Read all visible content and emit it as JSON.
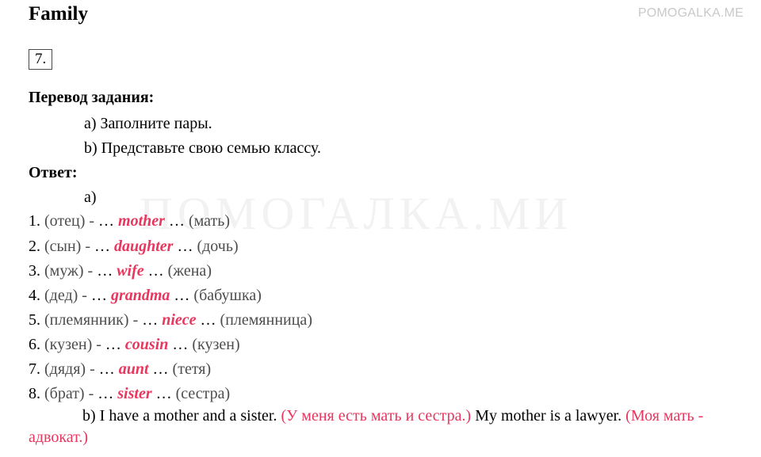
{
  "watermarks": {
    "top_right": "POMOGALKA.ME",
    "center": "ПОМОГАЛКА.МИ"
  },
  "document": {
    "title": "Family",
    "task_number": "7.",
    "translation_heading": "Перевод задания:",
    "translation_lines": [
      "a) Заполните пары.",
      "b) Представьте свою семью классу."
    ],
    "answer_heading": "Ответ:",
    "answer_part_a_label": "a)",
    "pairs": [
      {
        "num": "1.",
        "prompt": "(отец) -",
        "dots_before": "…",
        "answer": "mother",
        "dots_after": "…",
        "translation": "(мать)"
      },
      {
        "num": "2.",
        "prompt": "(сын) -",
        "dots_before": "…",
        "answer": "daughter",
        "dots_after": "…",
        "translation": "(дочь)"
      },
      {
        "num": "3.",
        "prompt": "(муж) -",
        "dots_before": "…",
        "answer": "wife",
        "dots_after": "…",
        "translation": "(жена)"
      },
      {
        "num": "4.",
        "prompt": "(дед) -",
        "dots_before": "…",
        "answer": "grandma",
        "dots_after": "…",
        "translation": "(бабушка)"
      },
      {
        "num": "5.",
        "prompt": "(племянник) -",
        "dots_before": "…",
        "answer": "niece",
        "dots_after": "…",
        "translation": "(племянница)"
      },
      {
        "num": "6.",
        "prompt": "(кузен) -",
        "dots_before": "…",
        "answer": "cousin",
        "dots_after": "…",
        "translation": "(кузен)"
      },
      {
        "num": "7.",
        "prompt": "(дядя) -",
        "dots_before": "…",
        "answer": "aunt",
        "dots_after": "…",
        "translation": "(тетя)"
      },
      {
        "num": "8.",
        "prompt": "(брат) -",
        "dots_before": "…",
        "answer": "sister",
        "dots_after": "…",
        "translation": "(сестра)"
      }
    ],
    "part_b": {
      "label": "b)",
      "sentence1": "I have a mother and a sister.",
      "note1": "(У меня есть мать и сестра.)",
      "sentence2": "My mother is a lawyer.",
      "note2": "(Моя мать - адвокат.)"
    }
  }
}
